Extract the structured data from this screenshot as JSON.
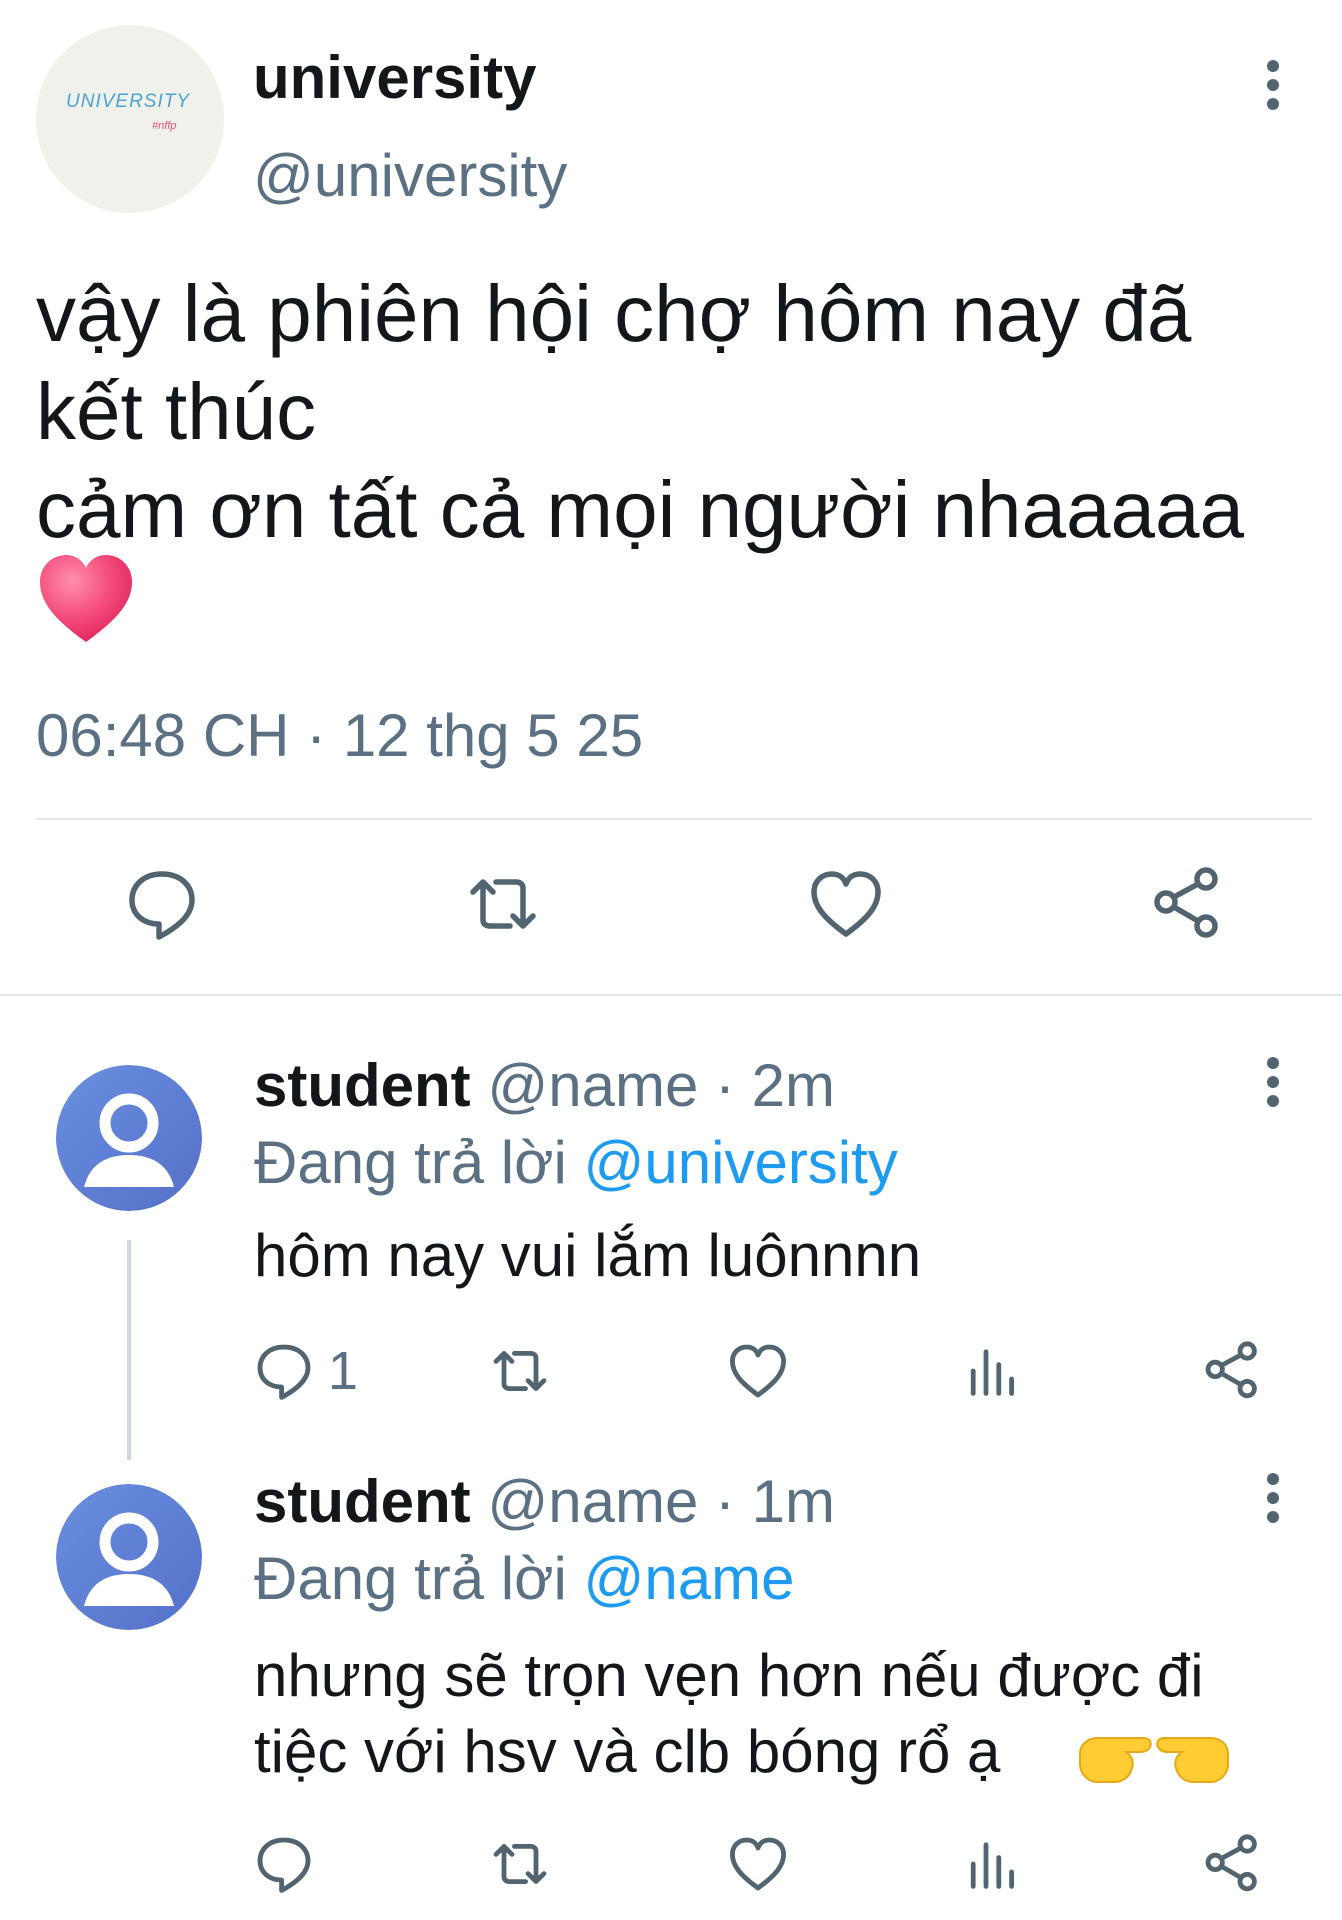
{
  "main_tweet": {
    "avatar_text": "UNIVERSITY",
    "avatar_subtext": "#nffp",
    "display_name": "university",
    "handle": "@university",
    "text": "vậy là phiên hội chợ hôm nay đã\nkết thúc\ncảm ơn tất cả mọi người nhaaaaa",
    "emoji": "heart",
    "time": "06:48 CH",
    "separator": " · ",
    "date": "12 thg 5 25"
  },
  "replies": [
    {
      "display_name": "student",
      "handle": "@name",
      "separator": " · ",
      "age": "2m",
      "replying_prefix": "Đang trả lời ",
      "replying_to": "@university",
      "text": "hôm nay vui lắm luônnnn",
      "reply_count": "1"
    },
    {
      "display_name": "student",
      "handle": "@name",
      "separator": " · ",
      "age": "1m",
      "replying_prefix": "Đang trả lời ",
      "replying_to": "@name",
      "text": "nhưng sẽ trọn vẹn hơn nếu được đi\ntiệc với hsv và clb bóng rổ ạ",
      "emoji": "pointing-hands"
    }
  ],
  "colors": {
    "text": "#14171a",
    "secondary": "#5b7083",
    "mention": "#1d9bf0",
    "divider": "#e1e6ea",
    "heart": "#f2557e"
  },
  "icons": [
    "more-vert-icon",
    "comment-icon",
    "retweet-icon",
    "like-icon",
    "share-icon",
    "analytics-icon",
    "user-avatar-icon"
  ]
}
